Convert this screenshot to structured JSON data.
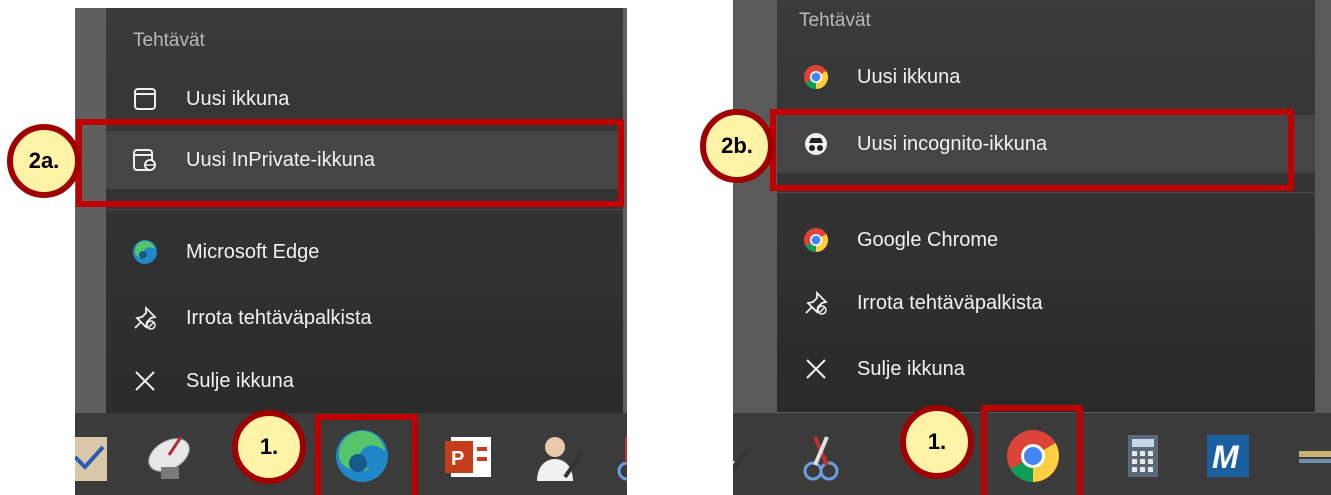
{
  "left_menu": {
    "section_title": "Tehtävät",
    "items": [
      {
        "label": "Uusi ikkuna",
        "icon": "window-icon"
      },
      {
        "label": "Uusi InPrivate-ikkuna",
        "icon": "inprivate-icon"
      },
      {
        "label": "Microsoft Edge",
        "icon": "edge-icon"
      },
      {
        "label": "Irrota tehtäväpalkista",
        "icon": "unpin-icon"
      },
      {
        "label": "Sulje ikkuna",
        "icon": "close-icon"
      }
    ],
    "callout_item": "2a.",
    "callout_taskbar": "1."
  },
  "right_menu": {
    "section_title": "Tehtävät",
    "items": [
      {
        "label": "Uusi ikkuna",
        "icon": "chrome-icon"
      },
      {
        "label": "Uusi incognito-ikkuna",
        "icon": "incognito-icon"
      },
      {
        "label": "Google Chrome",
        "icon": "chrome-icon"
      },
      {
        "label": "Irrota tehtäväpalkista",
        "icon": "unpin-icon"
      },
      {
        "label": "Sulje ikkuna",
        "icon": "close-icon"
      }
    ],
    "callout_item": "2b.",
    "callout_taskbar": "1."
  },
  "taskbar_icons_left": [
    "mail-icon",
    "satellite-icon",
    "edge-icon",
    "powerpoint-icon",
    "user-edit-icon",
    "snipping-tool-icon"
  ],
  "taskbar_icons_right": [
    "user-edit-icon",
    "snipping-tool-icon",
    "chrome-icon",
    "calculator-icon",
    "m-app-icon"
  ],
  "colors": {
    "highlight_border": "#c00000",
    "callout_fill": "#fff3a8",
    "callout_border": "#a00000"
  }
}
